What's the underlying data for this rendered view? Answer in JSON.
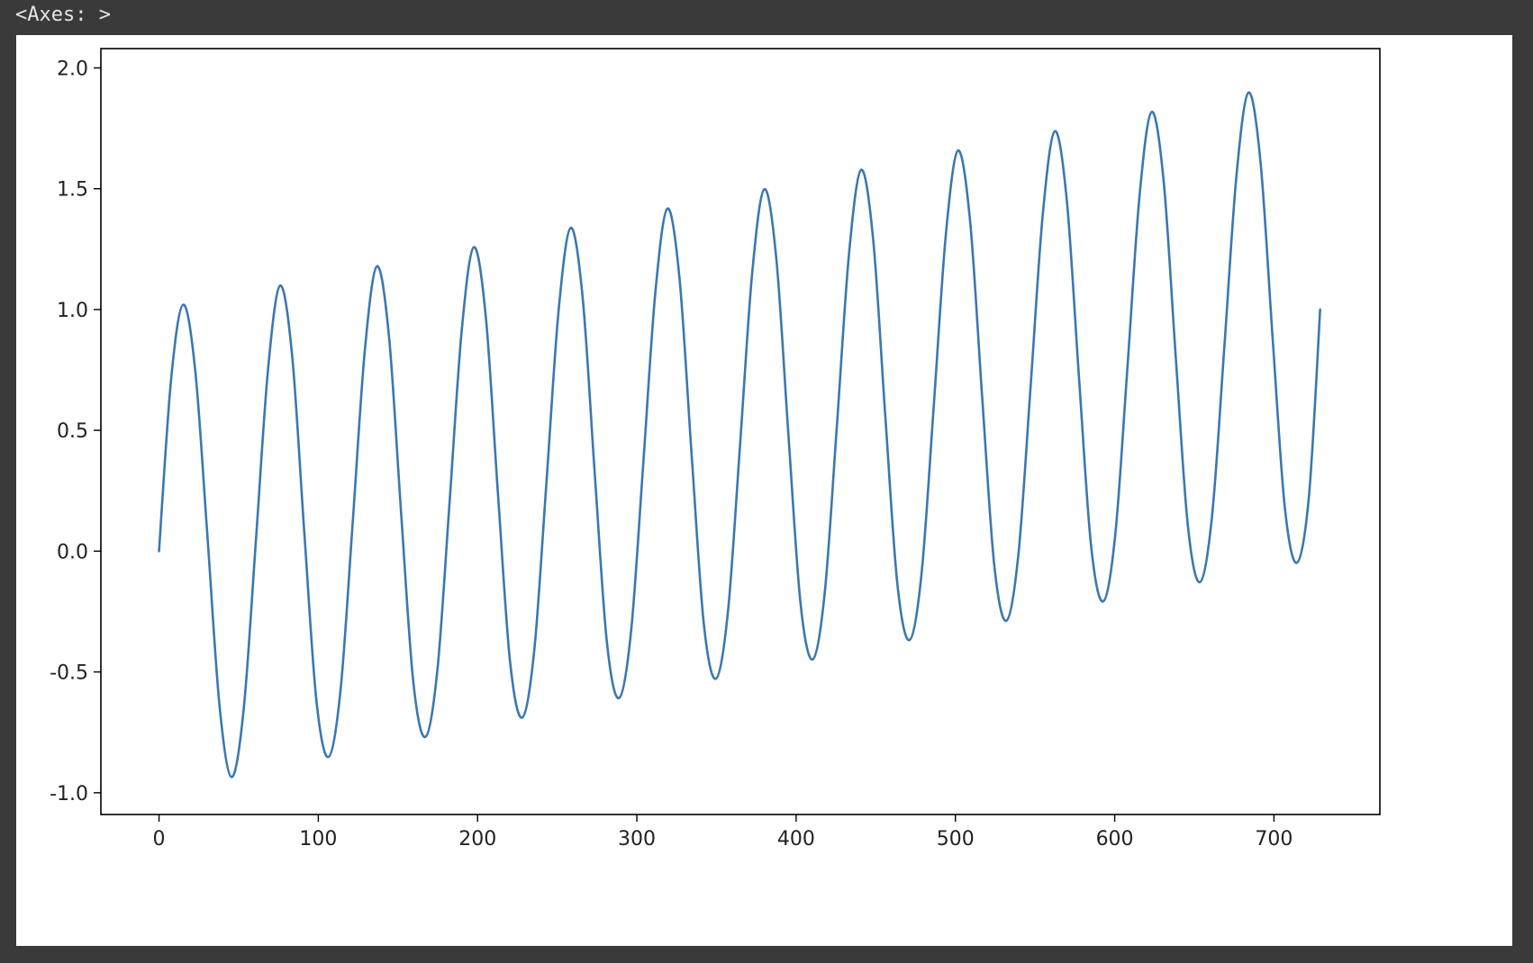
{
  "cell_output": {
    "label": "<Axes: >"
  },
  "colors": {
    "background": "#3a3a3a",
    "figure": "#ffffff",
    "line": "#3b78b0",
    "axes": "#000000"
  },
  "chart_data": {
    "type": "line",
    "title": "",
    "xlabel": "",
    "ylabel": "",
    "grid": false,
    "legend": null,
    "xlim": [
      -36.5,
      766.5
    ],
    "ylim": [
      -1.09,
      2.08
    ],
    "xticks": [
      0,
      100,
      200,
      300,
      400,
      500,
      600,
      700
    ],
    "xtick_labels": [
      "0",
      "100",
      "200",
      "300",
      "400",
      "500",
      "600",
      "700"
    ],
    "yticks": [
      -1.0,
      -0.5,
      0.0,
      0.5,
      1.0,
      1.5,
      2.0
    ],
    "ytick_labels": [
      "-1.0",
      "-0.5",
      "0.0",
      "0.5",
      "1.0",
      "1.5",
      "2.0"
    ],
    "series": [
      {
        "x": [
          0,
          7.6,
          15.2,
          22.8,
          30.4,
          38.0,
          45.6,
          53.2,
          60.8,
          68.4,
          76.0,
          83.6,
          91.2,
          98.8,
          106.4,
          114.0,
          121.6,
          129.2,
          136.8,
          144.4,
          152.0,
          159.6,
          167.2,
          174.8,
          182.4,
          190.0,
          197.6,
          205.2,
          212.8,
          220.4,
          228.0,
          235.6,
          243.2,
          250.8,
          258.4,
          266.0,
          273.6,
          281.2,
          288.8,
          296.4,
          304.0,
          311.6,
          319.2,
          326.8,
          334.4,
          342.0,
          349.6,
          357.2,
          364.8,
          372.4,
          380.0,
          387.6,
          395.2,
          402.8,
          410.4,
          418.0,
          425.6,
          433.2,
          440.8,
          448.4,
          456.0,
          463.6,
          471.2,
          478.8,
          486.4,
          494.0,
          501.6,
          509.2,
          516.8,
          524.4,
          532.0,
          539.6,
          547.2,
          554.8,
          562.4,
          570.0,
          577.6,
          585.2,
          592.8,
          600.4,
          608.0,
          615.6,
          623.2,
          630.8,
          638.4,
          646.0,
          653.6,
          661.2,
          668.8,
          676.4,
          684.0,
          691.6,
          699.2,
          706.8,
          714.4,
          722.0,
          729.0
        ],
        "y": [
          0.0,
          0.712,
          1.02,
          0.744,
          0.062,
          -0.64,
          -0.935,
          -0.652,
          0.04,
          0.749,
          1.099,
          0.808,
          0.079,
          -0.617,
          -0.852,
          -0.573,
          0.118,
          0.83,
          1.179,
          0.888,
          0.158,
          -0.538,
          -0.769,
          -0.49,
          0.2,
          0.91,
          1.258,
          0.968,
          0.238,
          -0.457,
          -0.689,
          -0.41,
          0.28,
          0.99,
          1.338,
          1.048,
          0.318,
          -0.377,
          -0.608,
          -0.33,
          0.36,
          1.07,
          1.418,
          1.128,
          0.398,
          -0.298,
          -0.528,
          -0.25,
          0.44,
          1.15,
          1.498,
          1.208,
          0.478,
          -0.218,
          -0.448,
          -0.17,
          0.52,
          1.23,
          1.578,
          1.288,
          0.558,
          -0.138,
          -0.368,
          -0.09,
          0.6,
          1.31,
          1.658,
          1.368,
          0.638,
          -0.058,
          -0.288,
          -0.01,
          0.68,
          1.39,
          1.738,
          1.448,
          0.718,
          0.022,
          -0.208,
          0.07,
          0.76,
          1.47,
          1.818,
          1.528,
          0.798,
          0.102,
          -0.128,
          0.15,
          0.84,
          1.55,
          1.898,
          1.608,
          0.878,
          0.182,
          -0.048,
          0.23,
          1.0
        ]
      }
    ]
  }
}
